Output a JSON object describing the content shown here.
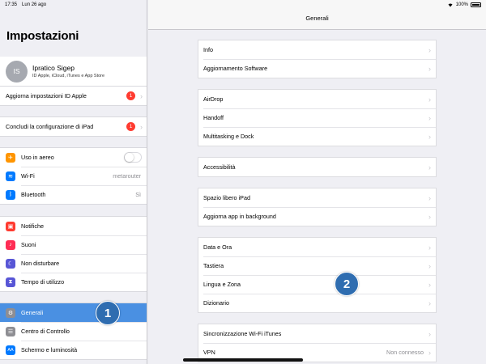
{
  "status": {
    "time": "17:35",
    "date": "Lun 26 ago",
    "battery": "100%"
  },
  "sidebar": {
    "title": "Impostazioni",
    "profile": {
      "initials": "IS",
      "name": "Ipratico Sigep",
      "subtitle": "ID Apple, iCloud, iTunes e App Store"
    },
    "update_row": {
      "label": "Aggiorna impostazioni ID Apple",
      "badge": "1"
    },
    "setup_row": {
      "label": "Concludi la configurazione di iPad",
      "badge": "1"
    },
    "connectivity": [
      {
        "label": "Uso in aereo",
        "icon": "airplane-icon",
        "color": "#ff9500",
        "glyph": "✈",
        "toggle": false
      },
      {
        "label": "Wi-Fi",
        "icon": "wifi-icon",
        "color": "#007aff",
        "glyph": "≋",
        "value": "metarouter"
      },
      {
        "label": "Bluetooth",
        "icon": "bluetooth-icon",
        "color": "#007aff",
        "glyph": "ᛒ",
        "value": "Sì"
      }
    ],
    "notifications": [
      {
        "label": "Notifiche",
        "icon": "notifications-icon",
        "color": "#ff3b30",
        "glyph": "▣"
      },
      {
        "label": "Suoni",
        "icon": "sounds-icon",
        "color": "#ff2d55",
        "glyph": "♪"
      },
      {
        "label": "Non disturbare",
        "icon": "moon-icon",
        "color": "#5856d6",
        "glyph": "☾"
      },
      {
        "label": "Tempo di utilizzo",
        "icon": "hourglass-icon",
        "color": "#5856d6",
        "glyph": "⧗"
      }
    ],
    "general": [
      {
        "label": "Generali",
        "icon": "gear-icon",
        "color": "#8e8e93",
        "glyph": "⚙",
        "selected": true
      },
      {
        "label": "Centro di Controllo",
        "icon": "control-center-icon",
        "color": "#8e8e93",
        "glyph": "☰"
      },
      {
        "label": "Schermo e luminosità",
        "icon": "display-icon",
        "color": "#007aff",
        "glyph": "AA"
      }
    ]
  },
  "detail": {
    "title": "Generali",
    "groups": [
      [
        {
          "label": "Info"
        },
        {
          "label": "Aggiornamento Software"
        }
      ],
      [
        {
          "label": "AirDrop"
        },
        {
          "label": "Handoff"
        },
        {
          "label": "Multitasking e Dock"
        }
      ],
      [
        {
          "label": "Accessibilità"
        }
      ],
      [
        {
          "label": "Spazio libero iPad"
        },
        {
          "label": "Aggiorna app in background"
        }
      ],
      [
        {
          "label": "Data e Ora"
        },
        {
          "label": "Tastiera"
        },
        {
          "label": "Lingua e Zona"
        },
        {
          "label": "Dizionario"
        }
      ],
      [
        {
          "label": "Sincronizzazione Wi-Fi iTunes"
        },
        {
          "label": "VPN",
          "value": "Non connesso"
        }
      ]
    ]
  },
  "callouts": [
    "1",
    "2"
  ],
  "colors": {
    "accent": "#4a90e2",
    "badge": "#ff3b30",
    "callout": "#2f6db0"
  }
}
